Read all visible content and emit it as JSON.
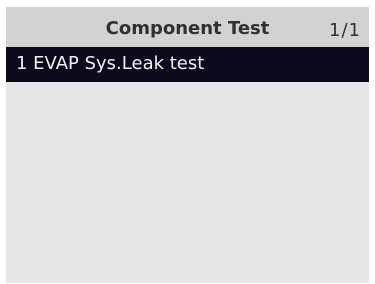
{
  "header": {
    "title": "Component Test",
    "page_indicator": "1/1"
  },
  "list": {
    "items": [
      {
        "label": "1 EVAP Sys.Leak test",
        "selected": true
      }
    ]
  },
  "colors": {
    "screen_background": "#e6e6e6",
    "header_background": "#d2d2d2",
    "selected_row_background": "#0b0b1d",
    "selected_row_text": "#f2f2f2",
    "header_text": "#303030"
  }
}
